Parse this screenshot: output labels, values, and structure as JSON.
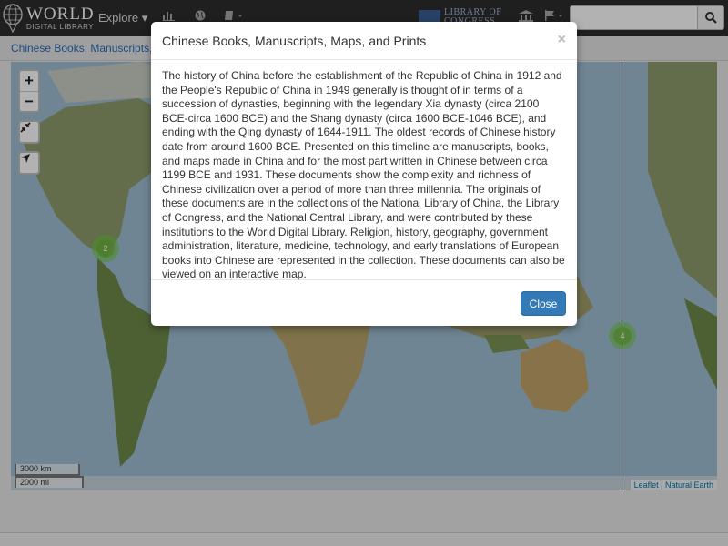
{
  "navbar": {
    "logo_title": "WORLD",
    "logo_subtitle": "DIGITAL LIBRARY",
    "explore_label": "Explore ▾",
    "loc_line1": "LIBRARY OF",
    "loc_line2": "CONGRESS"
  },
  "breadcrumb": {
    "text": "Chinese Books, Manuscripts, M"
  },
  "map": {
    "scale_km": "3000 km",
    "scale_mi": "2000 mi",
    "attribution_leaflet": "Leaflet",
    "attribution_sep": " | ",
    "attribution_ne": "Natural Earth",
    "clusters": [
      {
        "count": "2"
      },
      {
        "count": "4"
      }
    ],
    "zoom_in": "+",
    "zoom_out": "−"
  },
  "modal": {
    "title": "Chinese Books, Manuscripts, Maps, and Prints",
    "close_x": "×",
    "body": "The history of China before the establishment of the Republic of China in 1912 and the People's Republic of China in 1949 generally is thought of in terms of a succession of dynasties, beginning with the legendary Xia dynasty (circa 2100 BCE-circa 1600 BCE) and the Shang dynasty (circa 1600 BCE-1046 BCE), and ending with the Qing dynasty of 1644-1911. The oldest records of Chinese history date from around 1600 BCE. Presented on this timeline are manuscripts, books, and maps made in China and for the most part written in Chinese between circa 1199 BCE and 1931. These documents show the complexity and richness of Chinese civilization over a period of more than three millennia. The originals of these documents are in the collections of the National Library of China, the Library of Congress, and the National Central Library, and were contributed by these institutions to the World Digital Library. Religion, history, geography, government administration, literature, medicine, technology, and early translations of European books into Chinese are represented in the collection. These documents can also be viewed on an interactive map.",
    "close_button_label": "Close"
  }
}
